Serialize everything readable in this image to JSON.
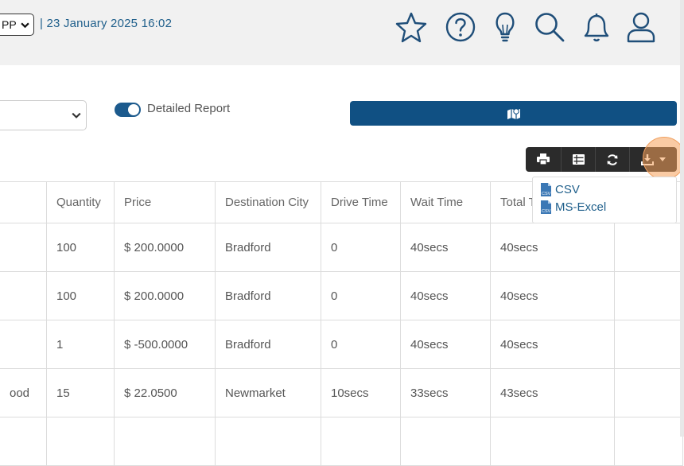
{
  "header": {
    "select_value": "PP",
    "datetime": "| 23 January 2025 16:02",
    "icons": [
      "star-icon",
      "help-icon",
      "lightbulb-icon",
      "search-icon",
      "bell-icon",
      "user-icon"
    ]
  },
  "filters": {
    "toggle_label": "Detailed Report",
    "toggle_on": true
  },
  "toolbar": {
    "icons": [
      "print-icon",
      "list-icon",
      "refresh-icon",
      "download-icon"
    ]
  },
  "export_menu": {
    "items": [
      {
        "label": "CSV",
        "icon": "csv-file-icon"
      },
      {
        "label": "MS-Excel",
        "icon": "csv-file-icon"
      }
    ]
  },
  "table": {
    "columns": [
      "",
      "Quantity",
      "Price",
      "Destination City",
      "Drive Time",
      "Wait Time",
      "Total T",
      ""
    ],
    "rows": [
      [
        "",
        "100",
        "$ 200.0000",
        "Bradford",
        "0",
        "40secs",
        "40secs",
        ""
      ],
      [
        "",
        "100",
        "$ 200.0000",
        "Bradford",
        "0",
        "40secs",
        "40secs",
        ""
      ],
      [
        "",
        "1",
        "$ -500.0000",
        "Bradford",
        "0",
        "40secs",
        "40secs",
        ""
      ],
      [
        "ood",
        "15",
        "$ 22.0500",
        "Newmarket",
        "10secs",
        "33secs",
        "43secs",
        ""
      ],
      [
        "",
        "",
        "",
        "",
        "",
        "",
        "",
        ""
      ]
    ]
  },
  "colors": {
    "topbar_bg": "#f1f1f1",
    "primary": "#105083",
    "link": "#1f5f8b",
    "toolbar_bg": "#2b2b2b",
    "focus": "#f5a05a"
  }
}
